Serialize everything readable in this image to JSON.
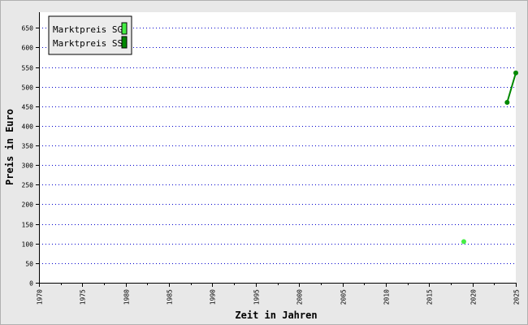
{
  "chart_data": {
    "type": "line",
    "title": "",
    "xlabel": "Zeit in Jahren",
    "ylabel": "Preis in Euro",
    "xlim": [
      1970,
      2025
    ],
    "ylim": [
      0,
      690
    ],
    "x_ticks": [
      1970,
      1975,
      1980,
      1985,
      1990,
      1995,
      2000,
      2005,
      2010,
      2015,
      2020,
      2025
    ],
    "y_ticks": [
      0,
      50,
      100,
      150,
      200,
      250,
      300,
      350,
      400,
      450,
      500,
      550,
      600,
      650
    ],
    "grid": "horizontal dotted",
    "legend_position": "top-left",
    "series": [
      {
        "name": "Marktpreis SG",
        "color": "#44ee44",
        "points": [
          {
            "x": 2019,
            "y": 105
          }
        ]
      },
      {
        "name": "Marktpreis SS",
        "color": "#008800",
        "points": [
          {
            "x": 2024,
            "y": 460
          },
          {
            "x": 2025,
            "y": 535
          }
        ]
      }
    ],
    "colors": {
      "background": "#e8e8e8",
      "plot_area": "#ffffff",
      "grid": "#0000cc"
    }
  }
}
